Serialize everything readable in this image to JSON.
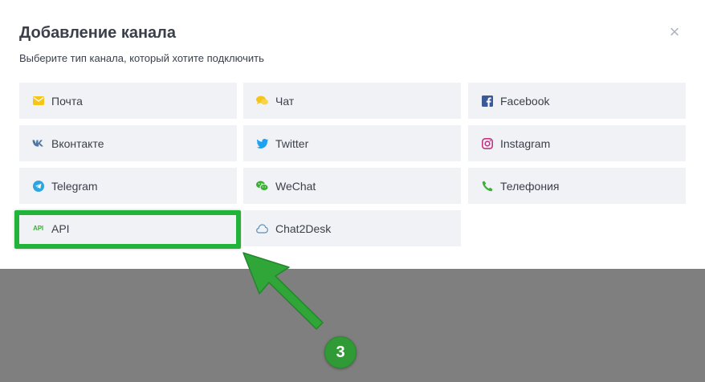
{
  "modal": {
    "title": "Добавление канала",
    "subtitle": "Выберите тип канала, который хотите подключить",
    "close_label": "×"
  },
  "channels": [
    {
      "label": "Почта",
      "icon": "mail-icon",
      "color": "#f5c518"
    },
    {
      "label": "Чат",
      "icon": "chat-icon",
      "color": "#f5c518"
    },
    {
      "label": "Facebook",
      "icon": "facebook-icon",
      "color": "#3b5998"
    },
    {
      "label": "Вконтакте",
      "icon": "vk-icon",
      "color": "#4a76a8"
    },
    {
      "label": "Twitter",
      "icon": "twitter-icon",
      "color": "#1da1f2"
    },
    {
      "label": "Instagram",
      "icon": "instagram-icon",
      "color": "#c13584"
    },
    {
      "label": "Telegram",
      "icon": "telegram-icon",
      "color": "#2ca5e0"
    },
    {
      "label": "WeChat",
      "icon": "wechat-icon",
      "color": "#3cb034"
    },
    {
      "label": "Телефония",
      "icon": "phone-icon",
      "color": "#3cb034"
    },
    {
      "label": "API",
      "icon": "api-icon",
      "icon_text": "API",
      "color": "#3cb034"
    },
    {
      "label": "Chat2Desk",
      "icon": "cloud-icon",
      "color": "#5b8fb9"
    }
  ],
  "annotation": {
    "step_number": "3",
    "highlight_color": "#22b33a"
  }
}
